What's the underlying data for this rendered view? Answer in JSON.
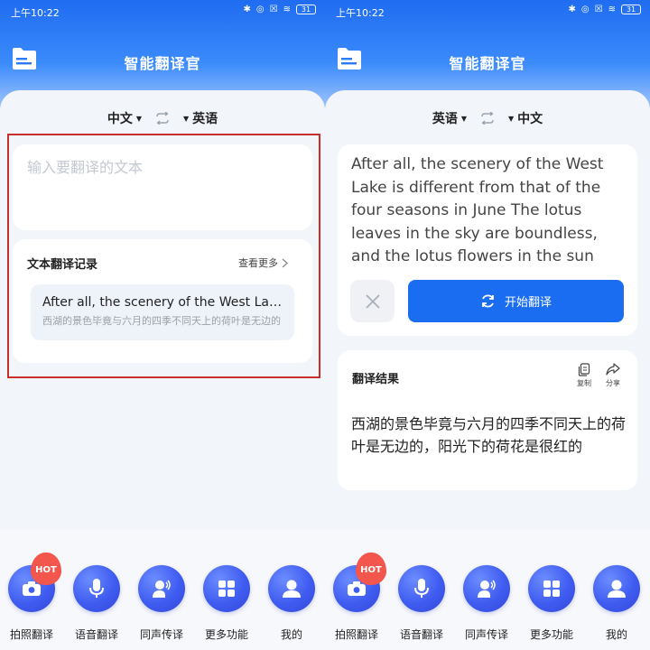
{
  "status_bar": {
    "time": "上午10:22",
    "battery": "31"
  },
  "app": {
    "title": "智能翻译官"
  },
  "left": {
    "source_lang": "中文",
    "target_lang": "英语",
    "input_placeholder": "输入要翻译的文本",
    "history": {
      "title": "文本翻译记录",
      "more": "查看更多",
      "items": [
        {
          "source": "After all, the scenery of the West Lake is different from that of the four seasons in June",
          "translation": "西湖的景色毕竟与六月的四季不同天上的荷叶是无边的"
        }
      ]
    }
  },
  "right": {
    "source_lang": "英语",
    "target_lang": "中文",
    "source_text": "After all, the scenery of the West Lake is different from that of the four seasons in June The lotus leaves in the sky are boundless, and the lotus flowers in the sun",
    "translate_button": "开始翻译",
    "result": {
      "title": "翻译结果",
      "copy": "复制",
      "share": "分享",
      "text": "西湖的景色毕竟与六月的四季不同天上的荷叶是无边的，阳光下的荷花是很红的"
    }
  },
  "nav": {
    "items": [
      {
        "label": "拍照翻译",
        "icon": "camera-icon"
      },
      {
        "label": "语音翻译",
        "icon": "microphone-icon"
      },
      {
        "label": "同声传译",
        "icon": "speaker-person-icon"
      },
      {
        "label": "更多功能",
        "icon": "grid-icon"
      },
      {
        "label": "我的",
        "icon": "user-icon"
      }
    ],
    "hot_badge": "HOT"
  },
  "colors": {
    "primary": "#1a6df0",
    "highlight_border": "#c8302c",
    "nav_icon": "#3f5cf0",
    "hot": "#f2564c"
  }
}
